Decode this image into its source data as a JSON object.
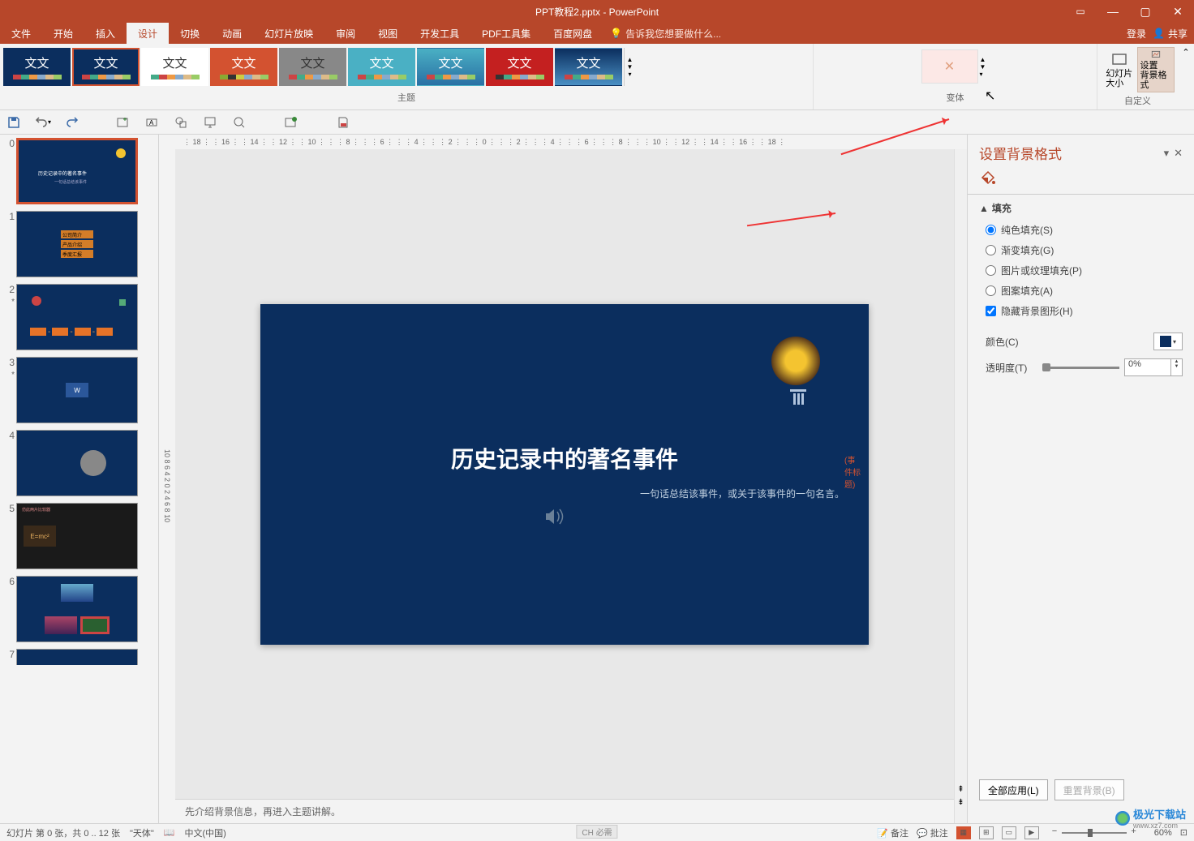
{
  "app": {
    "title": "PPT教程2.pptx - PowerPoint"
  },
  "tabs": {
    "file": "文件",
    "home": "开始",
    "insert": "插入",
    "design": "设计",
    "transitions": "切换",
    "animations": "动画",
    "slideshow": "幻灯片放映",
    "review": "审阅",
    "view": "视图",
    "developer": "开发工具",
    "pdf": "PDF工具集",
    "baidu": "百度网盘",
    "search_hint": "告诉我您想要做什么...",
    "login": "登录",
    "share": "共享"
  },
  "ribbon": {
    "themes_label": "主题",
    "variants_label": "变体",
    "customize_label": "自定义",
    "slide_size": "幻灯片\n大小",
    "format_bg": "设置\n背景格式",
    "theme_text": "文文"
  },
  "slide": {
    "title": "历史记录中的著名事件",
    "tag": "(事件标题)",
    "subtitle": "一句话总结该事件，或关于该事件的一句名言。",
    "notes": "先介绍背景信息，再进入主题讲解。"
  },
  "thumbnails": {
    "s2_items": [
      "公司简介",
      "产品介绍",
      "季度汇报"
    ],
    "s4_word": "W",
    "s6_formula": "E=mc²",
    "s6_title": "仿此两片比较器"
  },
  "pane": {
    "title": "设置背景格式",
    "section_fill": "填充",
    "opt_solid": "纯色填充(S)",
    "opt_gradient": "渐变填充(G)",
    "opt_picture": "图片或纹理填充(P)",
    "opt_pattern": "图案填充(A)",
    "opt_hide": "隐藏背景图形(H)",
    "color_label": "颜色(C)",
    "transparency_label": "透明度(T)",
    "transparency_value": "0%",
    "apply_all": "全部应用(L)",
    "reset": "重置背景(B)"
  },
  "statusbar": {
    "slide_info": "幻灯片 第 0 张，共 0 .. 12 张",
    "theme_name": "\"天体\"",
    "language": "中文(中国)",
    "notes_btn": "备注",
    "comments_btn": "批注",
    "zoom": "60%",
    "ime": "CH 必需"
  },
  "watermark": {
    "text": "极光下载站",
    "url": "www.xz7.com"
  }
}
